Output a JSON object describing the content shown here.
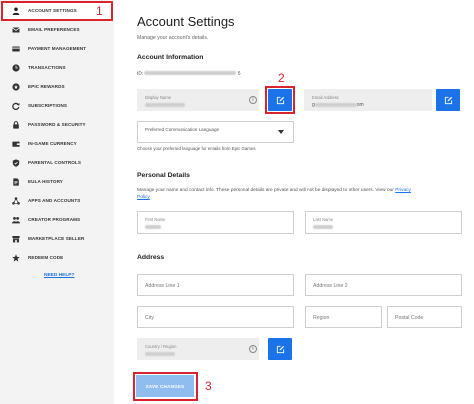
{
  "sidebar": {
    "items": [
      {
        "label": "ACCOUNT SETTINGS",
        "icon": "user-icon",
        "active": true
      },
      {
        "label": "EMAIL PREFERENCES",
        "icon": "envelope-icon"
      },
      {
        "label": "PAYMENT MANAGEMENT",
        "icon": "credit-card-icon"
      },
      {
        "label": "TRANSACTIONS",
        "icon": "clock-icon"
      },
      {
        "label": "EPIC REWARDS",
        "icon": "reward-icon"
      },
      {
        "label": "SUBSCRIPTIONS",
        "icon": "refresh-icon"
      },
      {
        "label": "PASSWORD & SECURITY",
        "icon": "lock-icon"
      },
      {
        "label": "IN-GAME CURRENCY",
        "icon": "wallet-icon"
      },
      {
        "label": "PARENTAL CONTROLS",
        "icon": "shield-icon"
      },
      {
        "label": "EULA HISTORY",
        "icon": "document-icon"
      },
      {
        "label": "APPS AND ACCOUNTS",
        "icon": "link-icon"
      },
      {
        "label": "CREATOR PROGRAMS",
        "icon": "people-icon"
      },
      {
        "label": "MARKETPLACE SELLER",
        "icon": "store-icon"
      },
      {
        "label": "REDEEM CODE",
        "icon": "star-icon"
      }
    ],
    "need_help": "NEED HELP?"
  },
  "annotations": {
    "one": "1",
    "two": "2",
    "three": "3"
  },
  "main": {
    "title": "Account Settings",
    "subtitle": "Manage your account's details.",
    "account_info": {
      "heading": "Account Information",
      "id_label": "ID:",
      "id_suffix": "5",
      "display_name_label": "Display Name",
      "email_label": "Email Address",
      "email_prefix": "g",
      "email_suffix": "om",
      "language_label": "Preferred Communication Language",
      "language_hint": "Choose your preferred language for emails from Epic Games"
    },
    "personal": {
      "heading": "Personal Details",
      "desc": "Manage your name and contact info. These personal details are private and will not be displayed to other users. View our ",
      "privacy_link_1": "Privacy",
      "privacy_link_2": "Policy",
      "first_name_label": "First Name",
      "last_name_label": "Last Name"
    },
    "address": {
      "heading": "Address",
      "line1_placeholder": "Address Line 1",
      "line2_placeholder": "Address Line 2",
      "city_placeholder": "City",
      "region_placeholder": "Region",
      "postal_placeholder": "Postal Code",
      "country_label": "Country / Region"
    },
    "save_label": "SAVE CHANGES"
  },
  "colors": {
    "accent": "#1a73e8",
    "annotation": "#d9232d",
    "save_disabled": "#8fbdf0"
  }
}
